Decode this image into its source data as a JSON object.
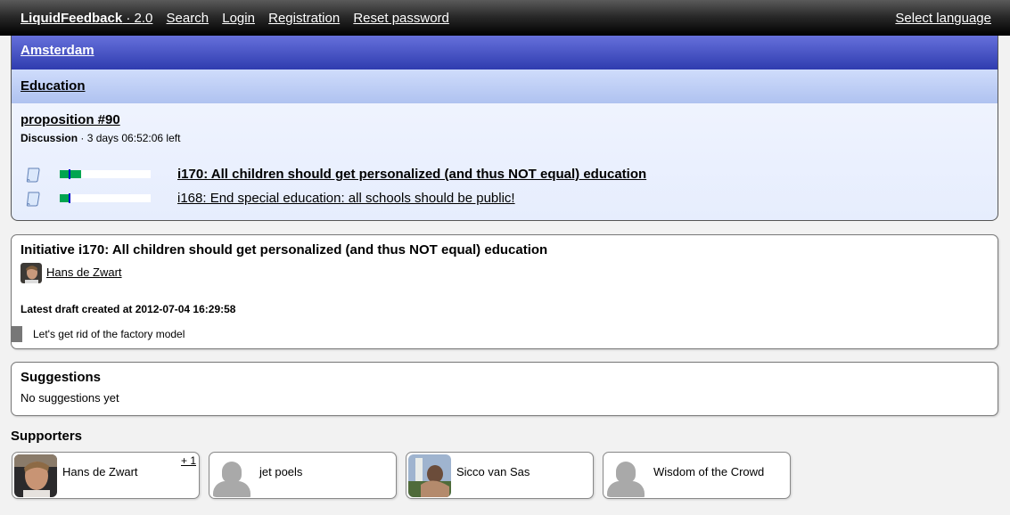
{
  "topbar": {
    "brand": "LiquidFeedback",
    "version": " · 2.0",
    "nav": [
      "Search",
      "Login",
      "Registration",
      "Reset password"
    ],
    "select_language": "Select language"
  },
  "unit": {
    "name": "Amsterdam"
  },
  "area": {
    "name": "Education"
  },
  "issue": {
    "title": "proposition #90",
    "state": "Discussion",
    "time_left": " · 3 days 06:52:06 left",
    "initiatives": [
      {
        "label": "i170: All children should get personalized (and thus NOT equal) education",
        "icon": "scroll-icon",
        "support_fraction": 0.24,
        "quorum_fraction": 0.1,
        "bold": true
      },
      {
        "label": "i168: End special education: all schools should be public!",
        "icon": "scroll-icon",
        "support_fraction": 0.1,
        "quorum_fraction": 0.1,
        "bold": false
      }
    ],
    "colors": {
      "support": "#00a550",
      "quorum": "#0000cc"
    }
  },
  "initiative": {
    "title": "Initiative i170: All children should get personalized (and thus NOT equal) education",
    "author": "Hans de Zwart",
    "draft_label": "Latest draft created at 2012-07-04 16:29:58",
    "draft_text": "Let's get rid of the factory model"
  },
  "suggestions": {
    "title": "Suggestions",
    "empty_text": "No suggestions yet"
  },
  "supporters": {
    "title": "Supporters",
    "items": [
      {
        "name": "Hans de Zwart",
        "badge": "+ 1",
        "avatar": "photo"
      },
      {
        "name": "jet poels",
        "badge": "",
        "avatar": "placeholder"
      },
      {
        "name": "Sicco van Sas",
        "badge": "",
        "avatar": "photo"
      },
      {
        "name": "Wisdom of the Crowd",
        "badge": "",
        "avatar": "placeholder"
      }
    ]
  }
}
